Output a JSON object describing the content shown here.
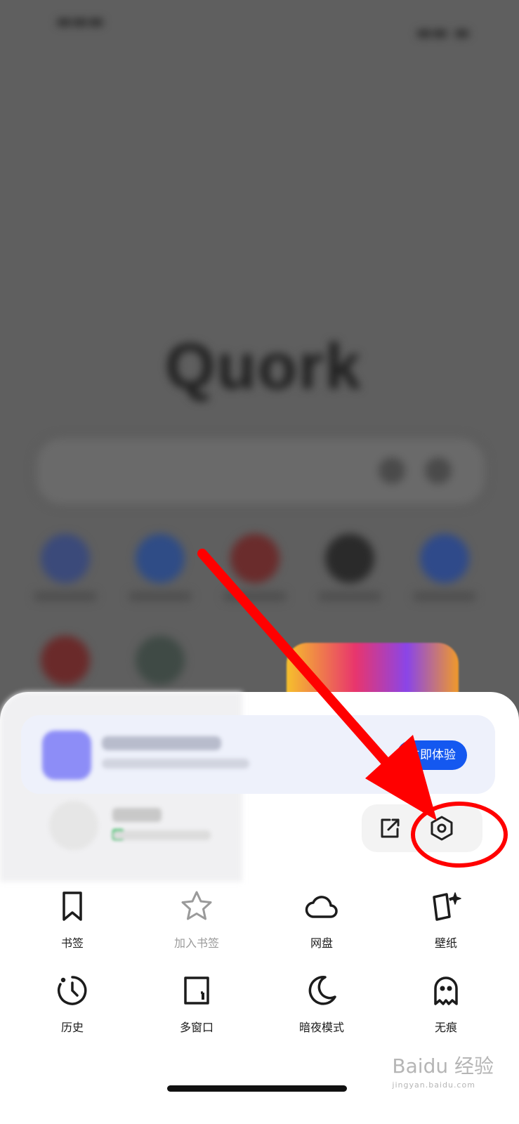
{
  "background": {
    "logo_text": "Quork"
  },
  "promo": {
    "button_label": "立即体验"
  },
  "menu": {
    "items": [
      {
        "label": "书签",
        "icon": "bookmark-icon"
      },
      {
        "label": "加入书签",
        "icon": "star-icon",
        "muted": true
      },
      {
        "label": "网盘",
        "icon": "cloud-icon"
      },
      {
        "label": "壁纸",
        "icon": "wallpaper-icon"
      },
      {
        "label": "历史",
        "icon": "history-icon"
      },
      {
        "label": "多窗口",
        "icon": "multi-window-icon"
      },
      {
        "label": "暗夜模式",
        "icon": "moon-icon"
      },
      {
        "label": "无痕",
        "icon": "ghost-icon"
      }
    ]
  },
  "toolbar": {
    "share_icon": "share-edit-icon",
    "settings_icon": "settings-hexagon-icon"
  },
  "watermark": {
    "brand": "Baidu 经验",
    "url": "jingyan.baidu.com"
  },
  "colors": {
    "accent": "#1458f0",
    "annotation": "#ff0000",
    "overlay": "#5f5f5f"
  }
}
